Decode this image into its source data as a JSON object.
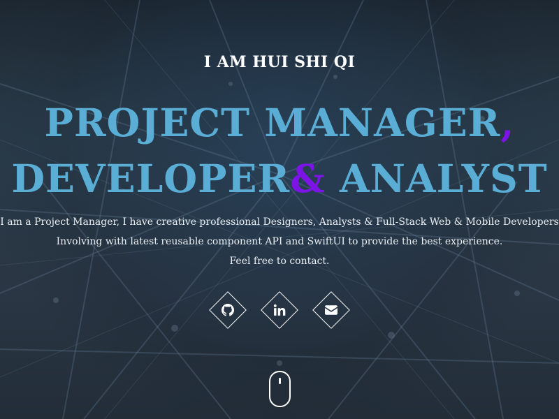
{
  "hero": {
    "intro": "I AM HUI SHI QI",
    "headline": {
      "part1": "PROJECT MANAGER",
      "comma": ",",
      "part2": "DEVELOPER",
      "amp": "&",
      "part3": " ANALYST"
    },
    "description": [
      "I am a Project Manager, I have creative professional Designers, Analysts & Full-Stack Web & Mobile Developers",
      "Involving with latest reusable component API and SwiftUI to provide the best experience.",
      "Feel free to contact."
    ]
  },
  "social": [
    {
      "icon": "github-icon"
    },
    {
      "icon": "linkedin-icon"
    },
    {
      "icon": "envelope-icon"
    }
  ],
  "scroll_indicator": {
    "icon": "mouse-icon"
  },
  "colors": {
    "headline": "#5aaed6",
    "accent": "#7c14e8",
    "text": "#ffffff"
  }
}
